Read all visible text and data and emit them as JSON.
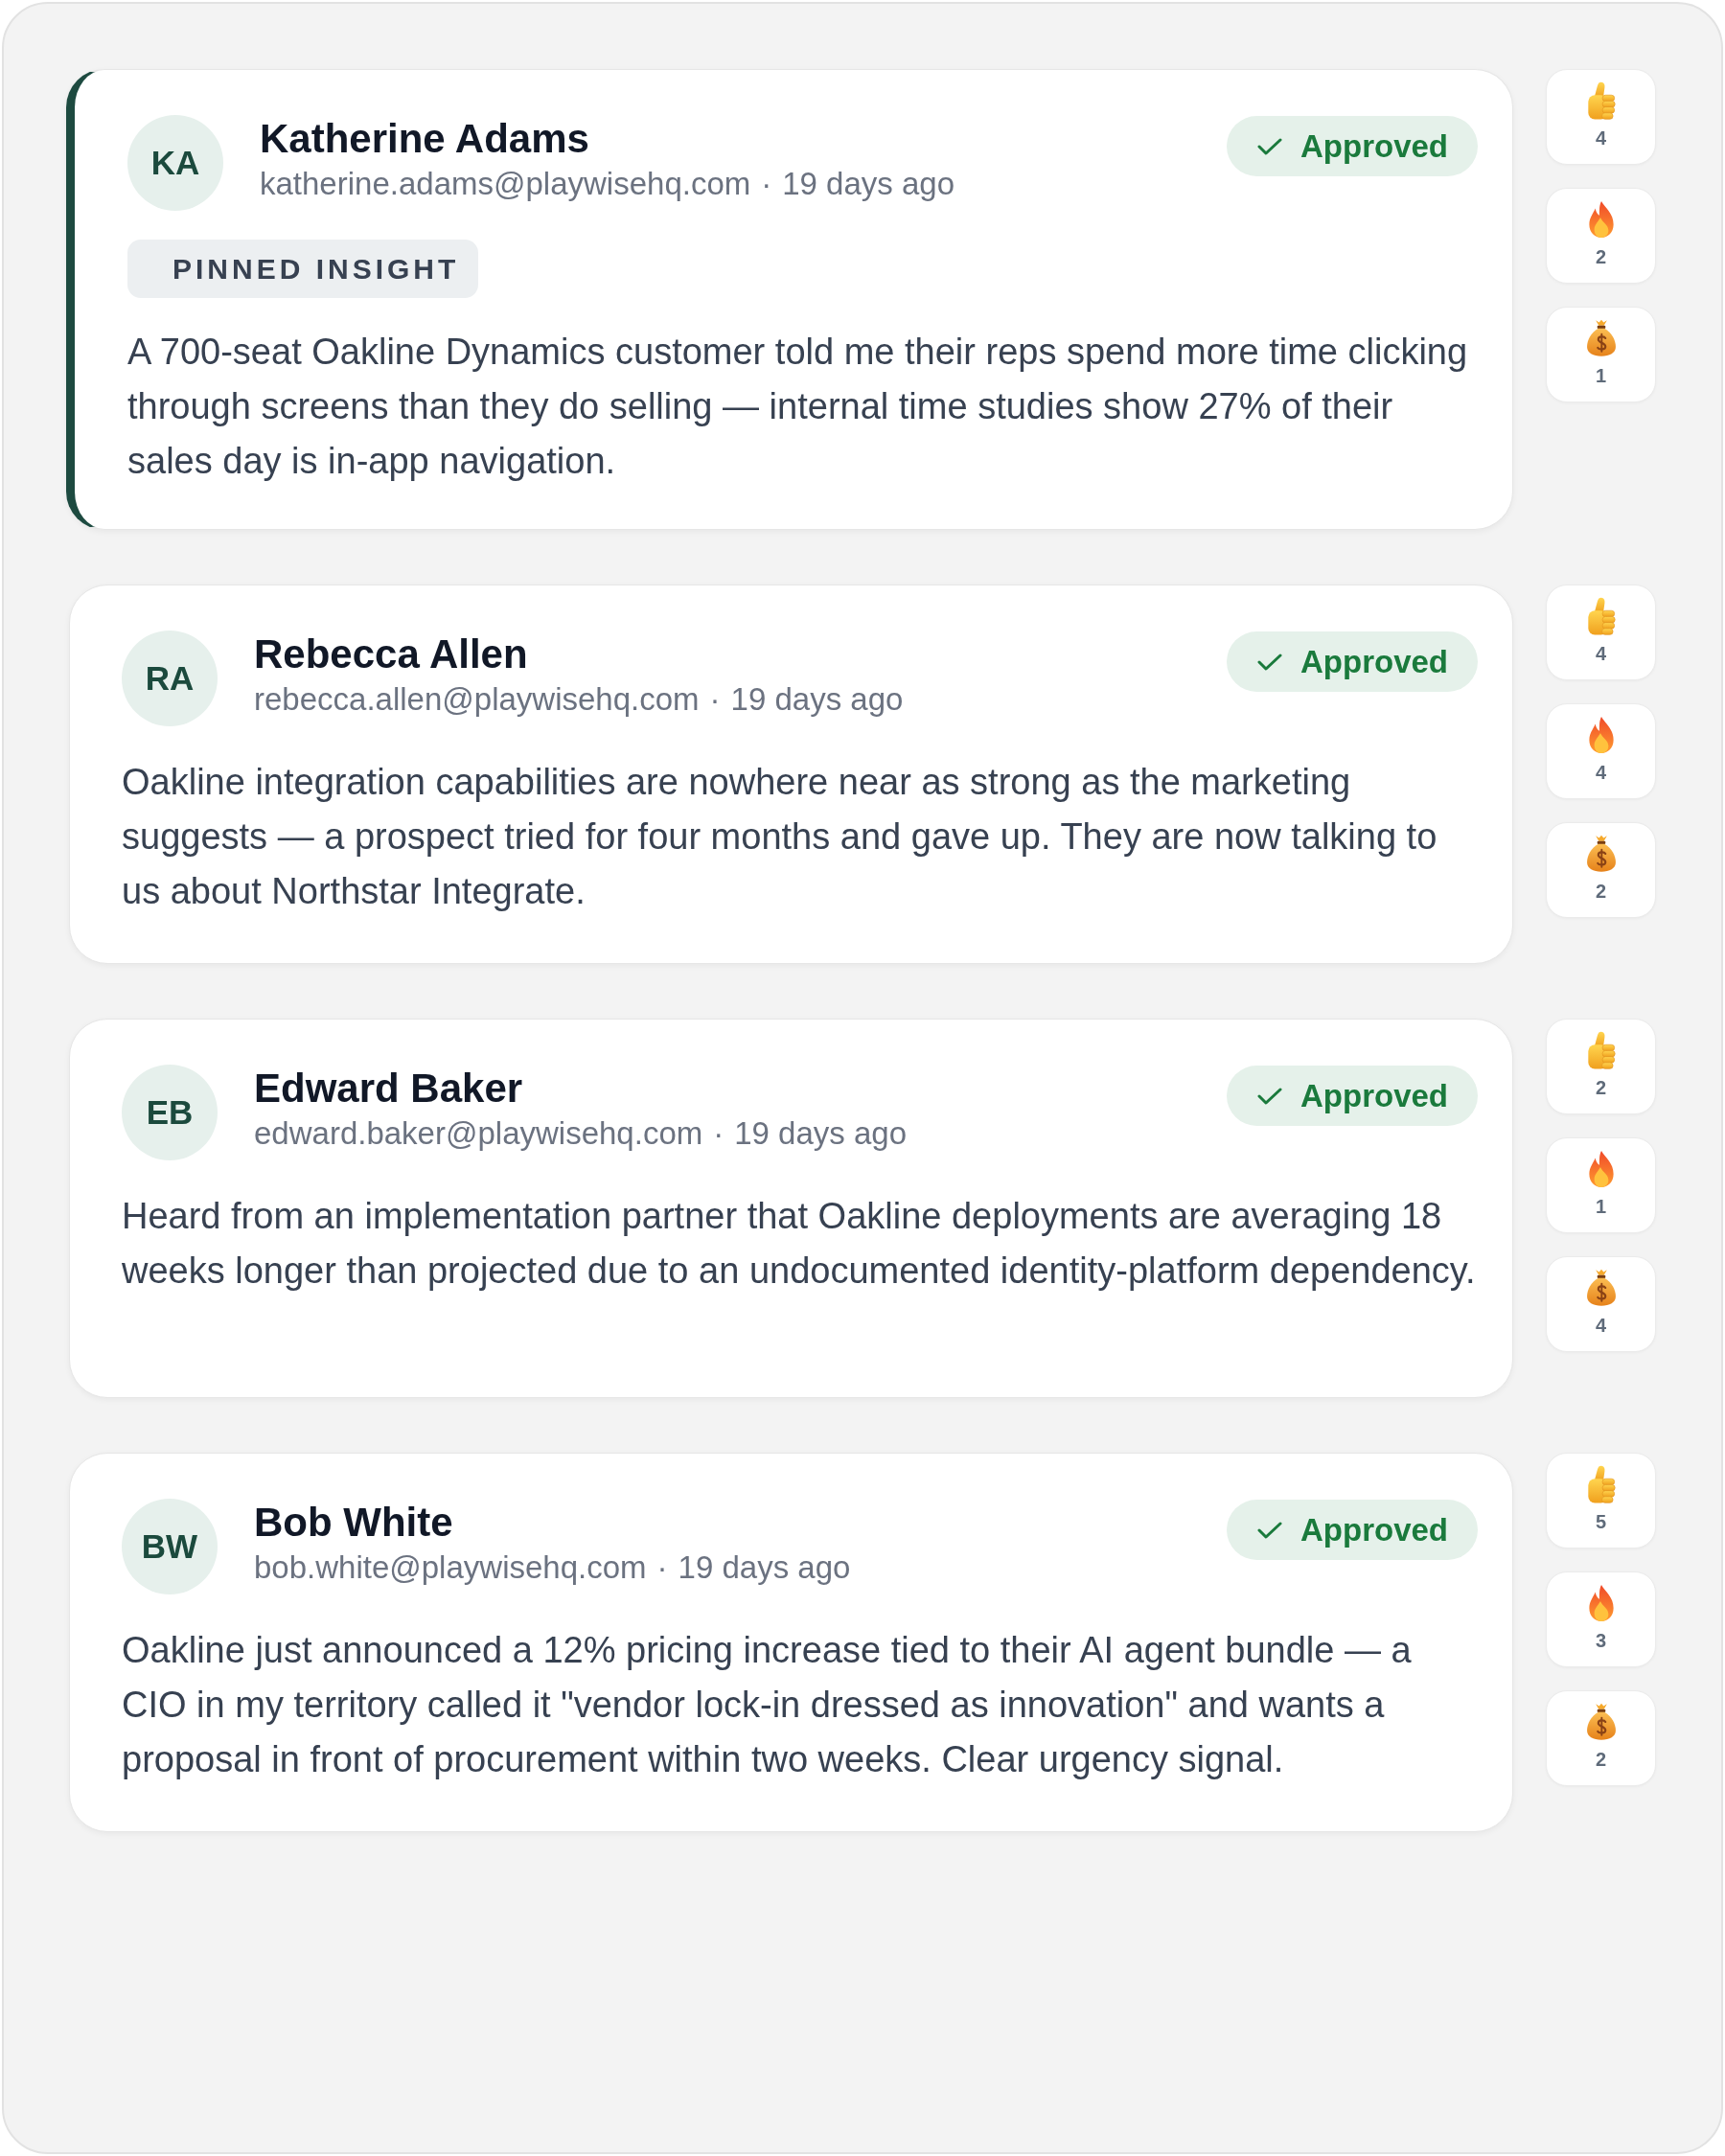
{
  "posts": [
    {
      "pinned": true,
      "pin_label": "PINNED INSIGHT",
      "author": {
        "initials": "KA",
        "name": "Katherine Adams",
        "email": "katherine.adams@playwisehq.com"
      },
      "separator": "·",
      "time": "19 days ago",
      "status": {
        "kind": "approved",
        "label": "Approved"
      },
      "text": "A 700-seat Oakline Dynamics customer told me their reps spend more time clicking through screens than they do selling — internal time studies show 27% of their sales day is in-app navigation.",
      "reactions": [
        {
          "kind": "thumbs_up",
          "count": "4"
        },
        {
          "kind": "fire",
          "count": "2"
        },
        {
          "kind": "money_bag",
          "count": "1"
        }
      ]
    },
    {
      "pinned": false,
      "author": {
        "initials": "RA",
        "name": "Rebecca Allen",
        "email": "rebecca.allen@playwisehq.com"
      },
      "separator": "·",
      "time": "19 days ago",
      "status": {
        "kind": "approved",
        "label": "Approved"
      },
      "text": "Oakline integration capabilities are nowhere near as strong as the marketing suggests — a prospect tried for four months and gave up. They are now talking to us about Northstar Integrate.",
      "reactions": [
        {
          "kind": "thumbs_up",
          "count": "4"
        },
        {
          "kind": "fire",
          "count": "4"
        },
        {
          "kind": "money_bag",
          "count": "2"
        }
      ]
    },
    {
      "pinned": false,
      "author": {
        "initials": "EB",
        "name": "Edward Baker",
        "email": "edward.baker@playwisehq.com"
      },
      "separator": "·",
      "time": "19 days ago",
      "status": {
        "kind": "approved",
        "label": "Approved"
      },
      "text": "Heard from an implementation partner that Oakline deployments are averaging 18 weeks longer than projected due to an undocumented identity-platform dependency.",
      "reactions": [
        {
          "kind": "thumbs_up",
          "count": "2"
        },
        {
          "kind": "fire",
          "count": "1"
        },
        {
          "kind": "money_bag",
          "count": "4"
        }
      ]
    },
    {
      "pinned": false,
      "author": {
        "initials": "BW",
        "name": "Bob White",
        "email": "bob.white@playwisehq.com"
      },
      "separator": "·",
      "time": "19 days ago",
      "status": {
        "kind": "approved",
        "label": "Approved"
      },
      "text": "Oakline just announced a 12% pricing increase tied to their AI agent bundle — a CIO in my territory called it \"vendor lock-in dressed as innovation\" and wants a proposal in front of procurement within two weeks. Clear urgency signal.",
      "reactions": [
        {
          "kind": "thumbs_up",
          "count": "5"
        },
        {
          "kind": "fire",
          "count": "3"
        },
        {
          "kind": "money_bag",
          "count": "2"
        }
      ]
    }
  ]
}
